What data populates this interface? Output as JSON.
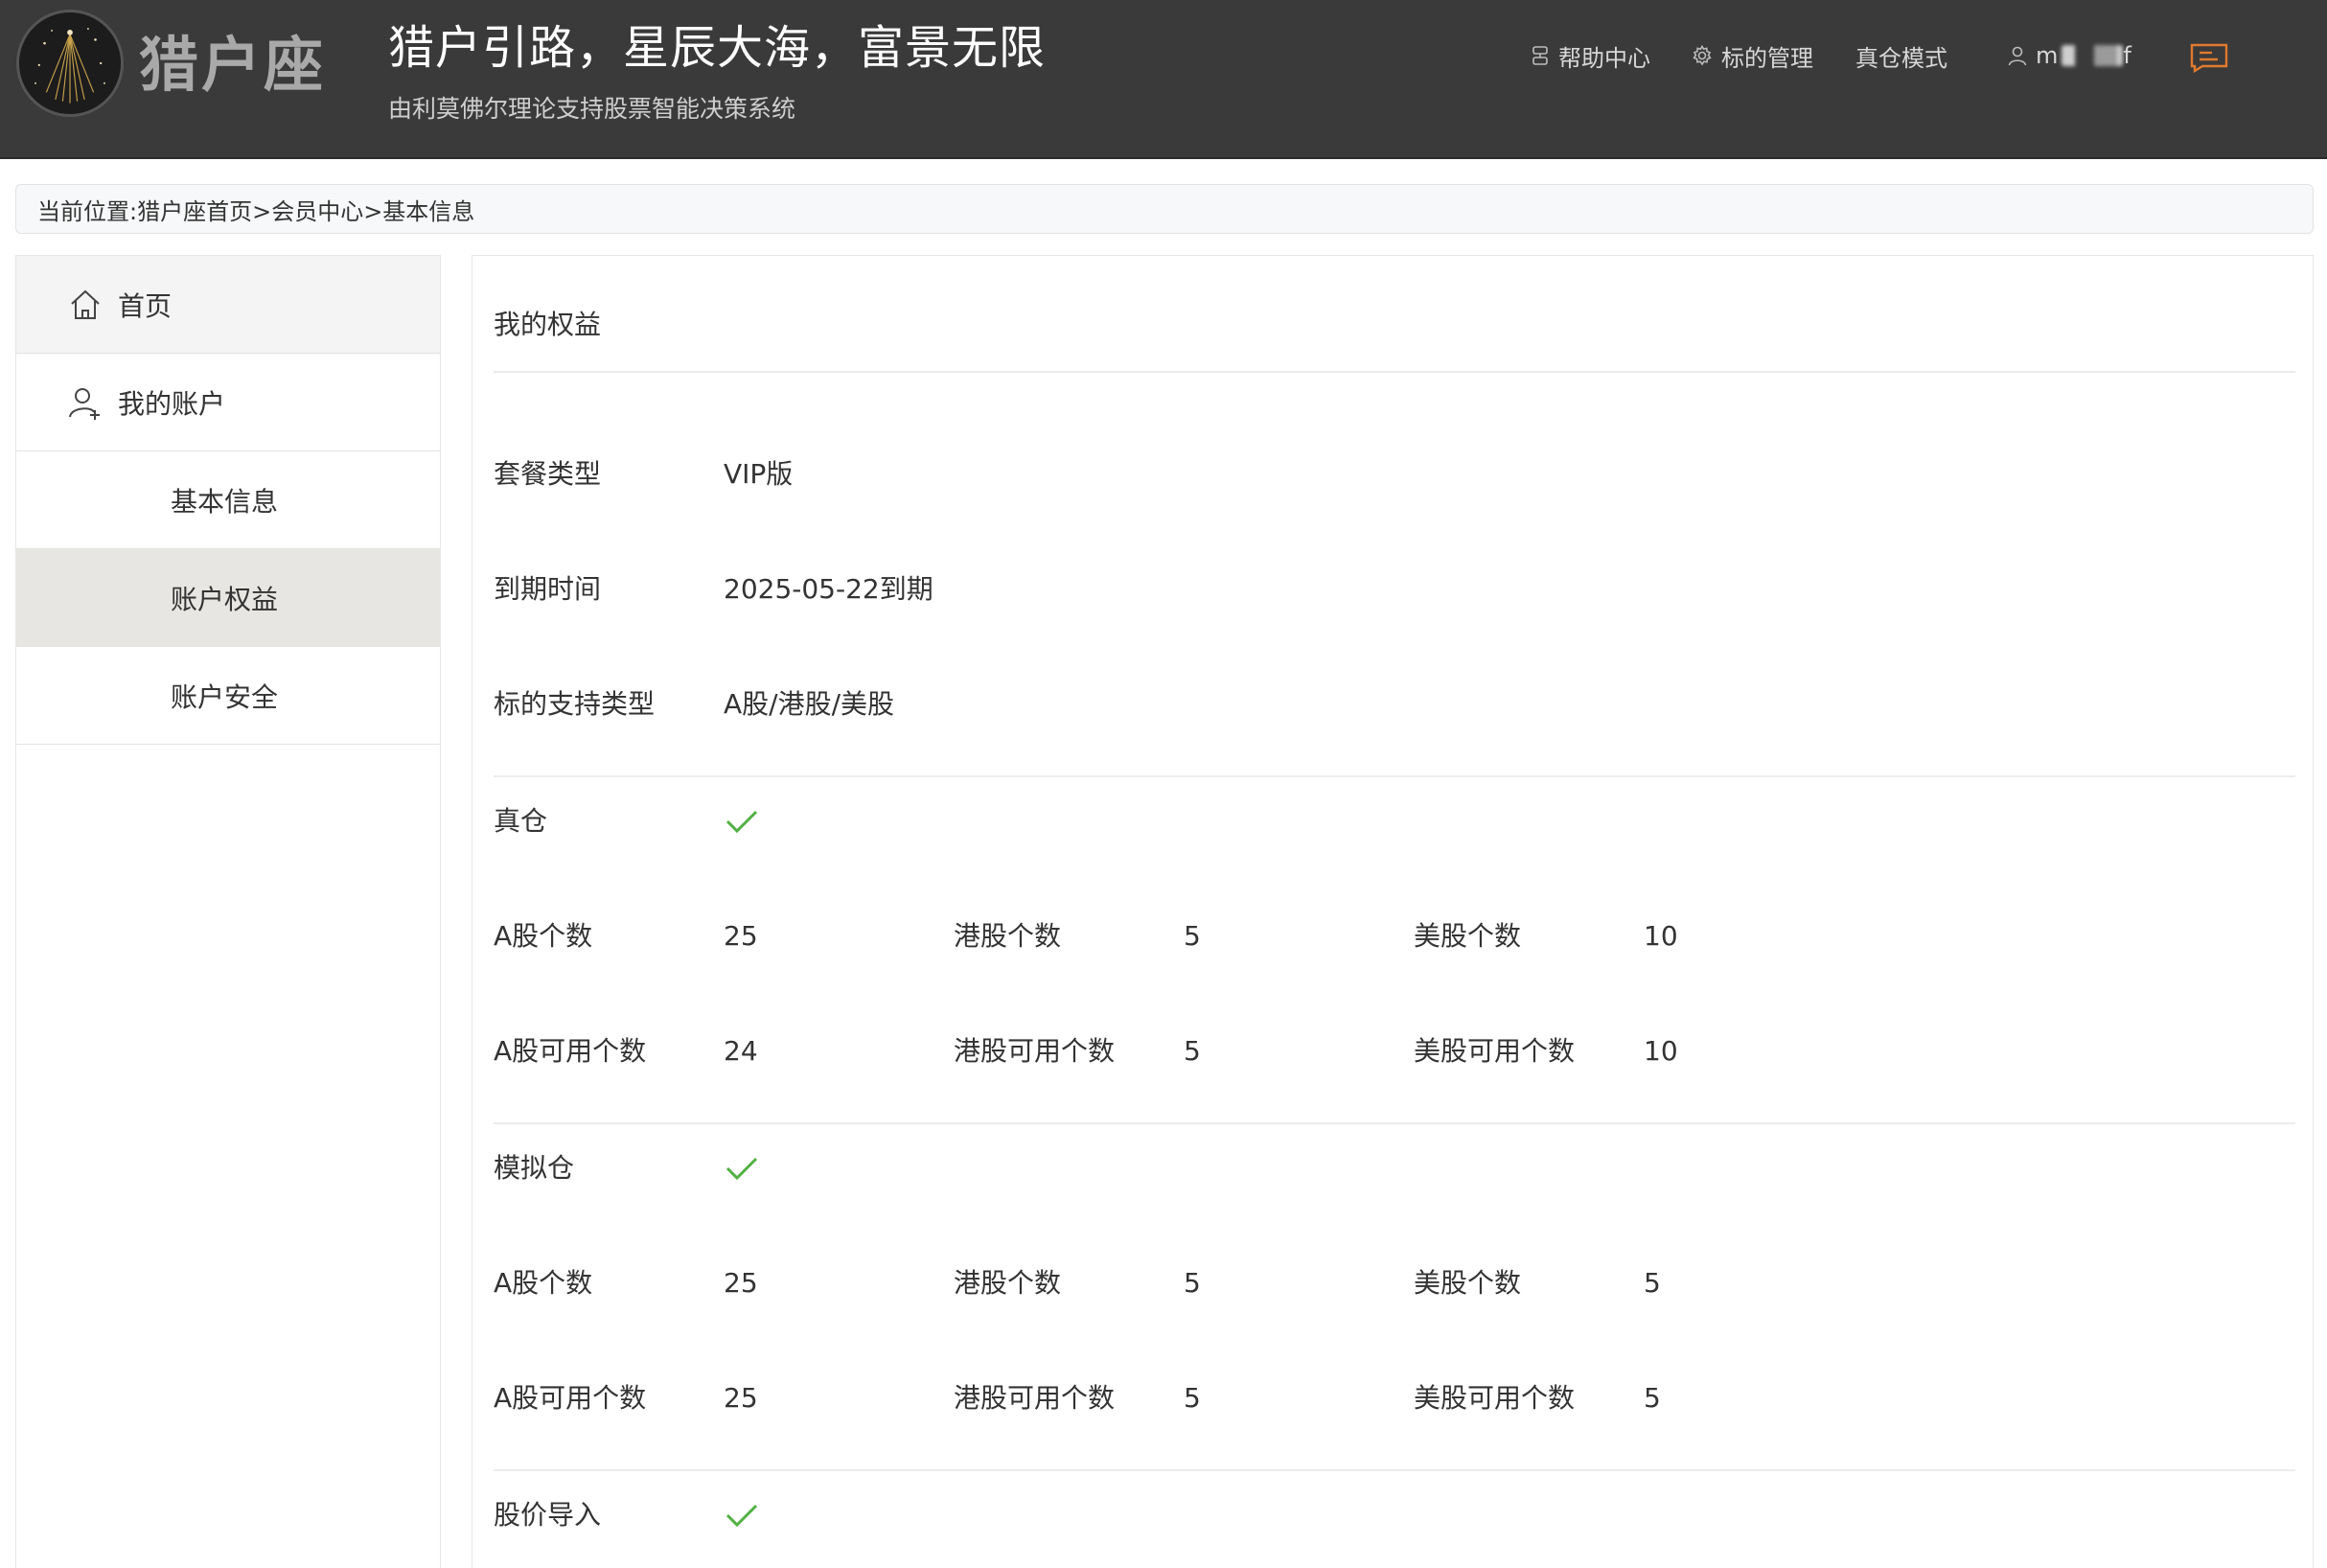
{
  "header": {
    "brand": "猎户座",
    "slogan": "猎户引路，星辰大海，富景无限",
    "subslogan": "由利莫佛尔理论支持股票智能决策系统",
    "nav": {
      "help": "帮助中心",
      "manage": "标的管理",
      "real_mode": "真仓模式",
      "user": "m",
      "user_suffix": "f"
    }
  },
  "breadcrumb": "当前位置:猎户座首页>会员中心>基本信息",
  "sidebar": {
    "items": [
      {
        "label": "首页",
        "icon": "home-icon"
      },
      {
        "label": "我的账户",
        "icon": "user-plus-icon"
      },
      {
        "label": "基本信息"
      },
      {
        "label": "账户权益"
      },
      {
        "label": "账户安全"
      }
    ]
  },
  "main": {
    "title": "我的权益",
    "package_label": "套餐类型",
    "package_value": "VIP版",
    "expire_label": "到期时间",
    "expire_value": "2025-05-22到期",
    "support_label": "标的支持类型",
    "support_value": "A股/港股/美股",
    "real": {
      "label": "真仓",
      "a_count_label": "A股个数",
      "a_count": "25",
      "hk_count_label": "港股个数",
      "hk_count": "5",
      "us_count_label": "美股个数",
      "us_count": "10",
      "a_avail_label": "A股可用个数",
      "a_avail": "24",
      "hk_avail_label": "港股可用个数",
      "hk_avail": "5",
      "us_avail_label": "美股可用个数",
      "us_avail": "10"
    },
    "sim": {
      "label": "模拟仓",
      "a_count_label": "A股个数",
      "a_count": "25",
      "hk_count_label": "港股个数",
      "hk_count": "5",
      "us_count_label": "美股个数",
      "us_count": "5",
      "a_avail_label": "A股可用个数",
      "a_avail": "25",
      "hk_avail_label": "港股可用个数",
      "hk_avail": "5",
      "us_avail_label": "美股可用个数",
      "us_avail": "5"
    },
    "import_label": "股价导入"
  },
  "colors": {
    "header_bg": "#3a3a3a",
    "check_green": "#52b043",
    "message_orange": "#e07a2e"
  }
}
